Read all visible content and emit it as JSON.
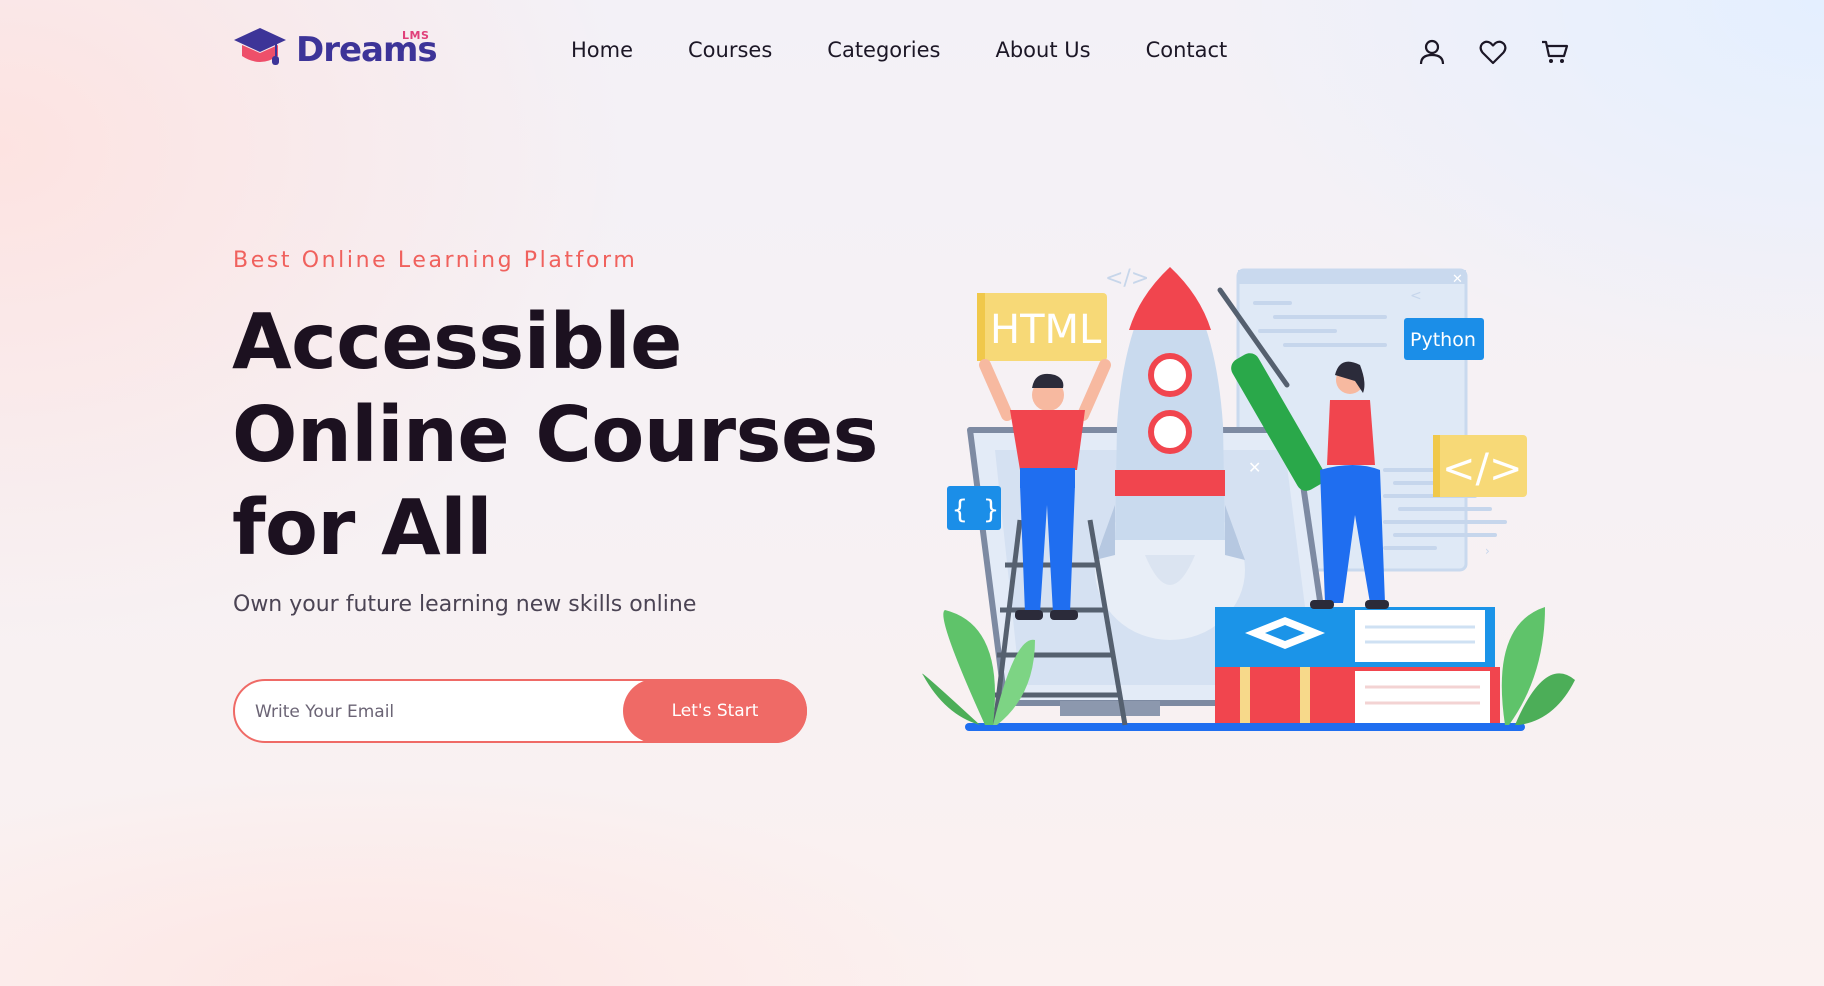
{
  "brand": {
    "name": "Dreams",
    "superscript": "LMS"
  },
  "nav": {
    "items": [
      {
        "label": "Home"
      },
      {
        "label": "Courses"
      },
      {
        "label": "Categories"
      },
      {
        "label": "About Us"
      },
      {
        "label": "Contact"
      }
    ]
  },
  "header_icons": [
    "user-icon",
    "heart-icon",
    "cart-icon"
  ],
  "hero": {
    "eyebrow": "Best Online Learning Platform",
    "headline_lines": [
      "Accessible",
      "Online Courses",
      "for All"
    ],
    "subhead": "Own your future learning new skills online",
    "email_placeholder": "Write Your Email",
    "cta_label": "Let's Start"
  },
  "illustration": {
    "tags": {
      "html": "HTML",
      "python": "Python",
      "code_tag": "</>",
      "braces": "{ }"
    }
  },
  "colors": {
    "accent": "#ef6a66",
    "brand": "#3d3498",
    "brand_pink": "#e0407a",
    "headline": "#1c1120"
  }
}
